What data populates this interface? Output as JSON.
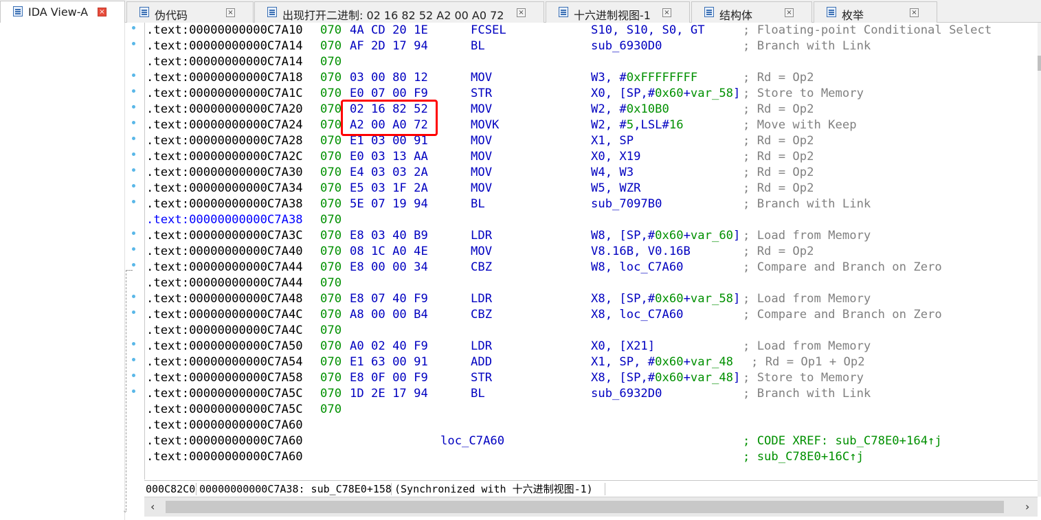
{
  "tabs": [
    {
      "label": "IDA View-A",
      "active": true,
      "icon": "listing-icon"
    },
    {
      "label": "伪代码",
      "active": false,
      "icon": "pseudocode-icon"
    },
    {
      "label": "出现打开二进制: 02 16 82 52 A2 00 A0 72",
      "active": false,
      "icon": "avatar-icon"
    },
    {
      "label": "十六进制视图-1",
      "active": false,
      "icon": "hex-view-icon"
    },
    {
      "label": "结构体",
      "active": false,
      "icon": "structures-icon"
    },
    {
      "label": "枚举",
      "active": false,
      "icon": "enums-icon"
    }
  ],
  "lines": [
    {
      "addr": ".text:00000000000C7A10",
      "lead": "070",
      "bytes": "4A CD 20 1E",
      "mnemonic": "FCSEL",
      "operands": "S10, S10, S0, GT",
      "comment": "; Floating-point Conditional Select"
    },
    {
      "addr": ".text:00000000000C7A14",
      "lead": "070",
      "bytes": "AF 2D 17 94",
      "mnemonic": "BL",
      "operands": "sub_6930D0",
      "comment": "; Branch with Link"
    },
    {
      "addr": ".text:00000000000C7A14",
      "lead": "070",
      "bytes": "",
      "mnemonic": "",
      "operands": "",
      "comment": ""
    },
    {
      "addr": ".text:00000000000C7A18",
      "lead": "070",
      "bytes": "03 00 80 12",
      "mnemonic": "MOV",
      "operands": "W3, #0xFFFFFFFF",
      "comment": "; Rd = Op2"
    },
    {
      "addr": ".text:00000000000C7A1C",
      "lead": "070",
      "bytes": "E0 07 00 F9",
      "mnemonic": "STR",
      "operands": "X0, [SP,#0x60+var_58]",
      "comment": "; Store to Memory"
    },
    {
      "addr": ".text:00000000000C7A20",
      "lead": "070",
      "bytes": "02 16 82 52",
      "mnemonic": "MOV",
      "operands": "W2, #0x10B0",
      "comment": "; Rd = Op2"
    },
    {
      "addr": ".text:00000000000C7A24",
      "lead": "070",
      "bytes": "A2 00 A0 72",
      "mnemonic": "MOVK",
      "operands": "W2, #5,LSL#16",
      "comment": "; Move with Keep"
    },
    {
      "addr": ".text:00000000000C7A28",
      "lead": "070",
      "bytes": "E1 03 00 91",
      "mnemonic": "MOV",
      "operands": "X1, SP",
      "comment": "; Rd = Op2"
    },
    {
      "addr": ".text:00000000000C7A2C",
      "lead": "070",
      "bytes": "E0 03 13 AA",
      "mnemonic": "MOV",
      "operands": "X0, X19",
      "comment": "; Rd = Op2"
    },
    {
      "addr": ".text:00000000000C7A30",
      "lead": "070",
      "bytes": "E4 03 03 2A",
      "mnemonic": "MOV",
      "operands": "W4, W3",
      "comment": "; Rd = Op2"
    },
    {
      "addr": ".text:00000000000C7A34",
      "lead": "070",
      "bytes": "E5 03 1F 2A",
      "mnemonic": "MOV",
      "operands": "W5, WZR",
      "comment": "; Rd = Op2"
    },
    {
      "addr": ".text:00000000000C7A38",
      "lead": "070",
      "bytes": "5E 07 19 94",
      "mnemonic": "BL",
      "operands": "sub_7097B0",
      "comment": "; Branch with Link"
    },
    {
      "addr": ".text:00000000000C7A38",
      "lead": "070",
      "bytes": "",
      "mnemonic": "",
      "operands": "",
      "comment": "",
      "xref": true
    },
    {
      "addr": ".text:00000000000C7A3C",
      "lead": "070",
      "bytes": "E8 03 40 B9",
      "mnemonic": "LDR",
      "operands": "W8, [SP,#0x60+var_60]",
      "comment": "; Load from Memory"
    },
    {
      "addr": ".text:00000000000C7A40",
      "lead": "070",
      "bytes": "08 1C A0 4E",
      "mnemonic": "MOV",
      "operands": "V8.16B, V0.16B",
      "comment": "; Rd = Op2"
    },
    {
      "addr": ".text:00000000000C7A44",
      "lead": "070",
      "bytes": "E8 00 00 34",
      "mnemonic": "CBZ",
      "operands": "W8, loc_C7A60",
      "comment": "; Compare and Branch on Zero"
    },
    {
      "addr": ".text:00000000000C7A44",
      "lead": "070",
      "bytes": "",
      "mnemonic": "",
      "operands": "",
      "comment": ""
    },
    {
      "addr": ".text:00000000000C7A48",
      "lead": "070",
      "bytes": "E8 07 40 F9",
      "mnemonic": "LDR",
      "operands": "X8, [SP,#0x60+var_58]",
      "comment": "; Load from Memory"
    },
    {
      "addr": ".text:00000000000C7A4C",
      "lead": "070",
      "bytes": "A8 00 00 B4",
      "mnemonic": "CBZ",
      "operands": "X8, loc_C7A60",
      "comment": "; Compare and Branch on Zero"
    },
    {
      "addr": ".text:00000000000C7A4C",
      "lead": "070",
      "bytes": "",
      "mnemonic": "",
      "operands": "",
      "comment": ""
    },
    {
      "addr": ".text:00000000000C7A50",
      "lead": "070",
      "bytes": "A0 02 40 F9",
      "mnemonic": "LDR",
      "operands": "X0, [X21]",
      "comment": "; Load from Memory"
    },
    {
      "addr": ".text:00000000000C7A54",
      "lead": "070",
      "bytes": "E1 63 00 91",
      "mnemonic": "ADD",
      "operands": "X1, SP, #0x60+var_48",
      "comment": "; Rd = Op1 + Op2",
      "commentShift": true
    },
    {
      "addr": ".text:00000000000C7A58",
      "lead": "070",
      "bytes": "E8 0F 00 F9",
      "mnemonic": "STR",
      "operands": "X8, [SP,#0x60+var_48]",
      "comment": "; Store to Memory"
    },
    {
      "addr": ".text:00000000000C7A5C",
      "lead": "070",
      "bytes": "1D 2E 17 94",
      "mnemonic": "BL",
      "operands": "sub_6932D0",
      "comment": "; Branch with Link"
    },
    {
      "addr": ".text:00000000000C7A5C",
      "lead": "070",
      "bytes": "",
      "mnemonic": "",
      "operands": "",
      "comment": ""
    },
    {
      "addr": ".text:00000000000C7A60",
      "lead": "",
      "bytes": "",
      "mnemonic": "",
      "operands": "",
      "comment": ""
    },
    {
      "addr": ".text:00000000000C7A60",
      "lead": "",
      "bytes": "",
      "mnemonic": "",
      "operands": "",
      "comment": "; CODE XREF: sub_C78E0+164↑j",
      "label": "loc_C7A60",
      "xrefComment": true
    },
    {
      "addr": ".text:00000000000C7A60",
      "lead": "",
      "bytes": "",
      "mnemonic": "",
      "operands": "",
      "comment": "; sub_C78E0+16C↑j",
      "xrefComment": true
    }
  ],
  "highlight": {
    "color": "#ff0000",
    "bytes": [
      "02 16 82 52",
      "A2 00 A0 72"
    ]
  },
  "status": {
    "offset": "000C82C0",
    "location": "00000000000C7A38: sub_C78E0+158",
    "sync": "(Synchronized with 十六进制视图-1)"
  },
  "colors": {
    "address": "#000000",
    "xref_address": "#0000ff",
    "opcode": "#0000c0",
    "immediate": "#009000",
    "comment": "#808080",
    "gutter_dot": "#59b7e8"
  }
}
